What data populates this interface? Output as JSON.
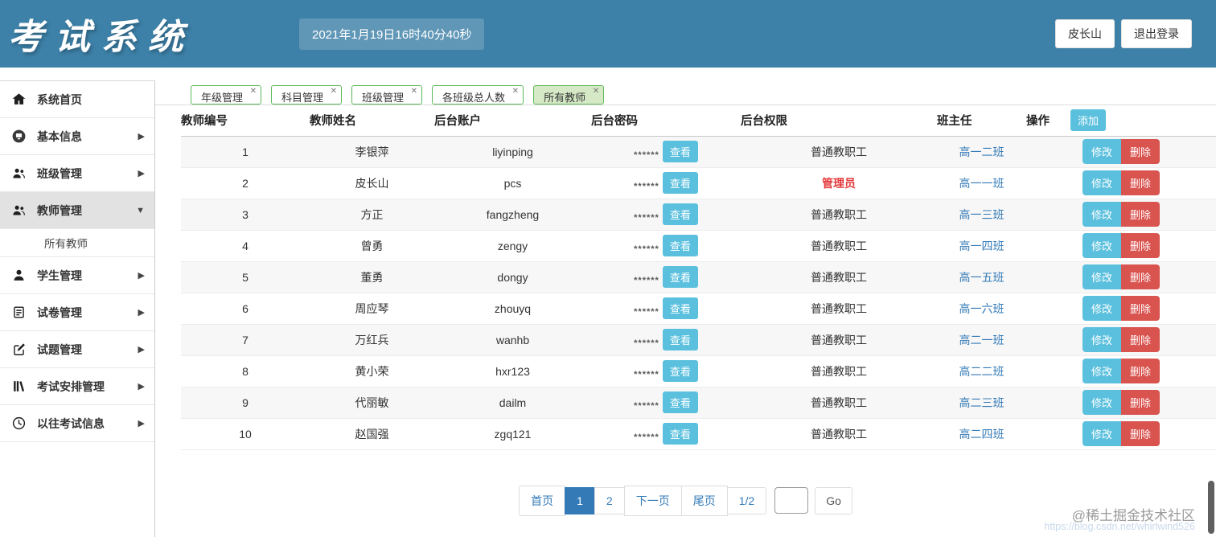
{
  "header": {
    "logo": "考试系统",
    "clock": "2021年1月19日16时40分40秒",
    "user_button": "皮长山",
    "logout_button": "退出登录"
  },
  "sidebar": {
    "items": [
      {
        "label": "系统首页",
        "icon": "home-icon"
      },
      {
        "label": "基本信息",
        "icon": "monitor-circle-icon"
      },
      {
        "label": "班级管理",
        "icon": "people-group-icon"
      },
      {
        "label": "教师管理",
        "icon": "people-group-icon"
      },
      {
        "label": "学生管理",
        "icon": "person-icon"
      },
      {
        "label": "试卷管理",
        "icon": "document-icon"
      },
      {
        "label": "试题管理",
        "icon": "compose-icon"
      },
      {
        "label": "考试安排管理",
        "icon": "books-icon"
      },
      {
        "label": "以往考试信息",
        "icon": "clock-icon"
      }
    ],
    "submenu_item": "所有教师"
  },
  "tabs": [
    {
      "label": "年级管理"
    },
    {
      "label": "科目管理"
    },
    {
      "label": "班级管理"
    },
    {
      "label": "各班级总人数"
    },
    {
      "label": "所有教师"
    }
  ],
  "table": {
    "headers": {
      "id": "教师编号",
      "name": "教师姓名",
      "account": "后台账户",
      "password": "后台密码",
      "permission": "后台权限",
      "head_teacher": "班主任",
      "actions": "操作"
    },
    "add_button": "添加",
    "view_button": "查看",
    "edit_button": "修改",
    "delete_button": "删除",
    "rows": [
      {
        "id": "1",
        "name": "李银萍",
        "account": "liyinping",
        "password_mask": "******",
        "permission": "普通教职工",
        "head_teacher": "高一二班"
      },
      {
        "id": "2",
        "name": "皮长山",
        "account": "pcs",
        "password_mask": "******",
        "permission": "管理员",
        "head_teacher": "高一一班"
      },
      {
        "id": "3",
        "name": "方正",
        "account": "fangzheng",
        "password_mask": "******",
        "permission": "普通教职工",
        "head_teacher": "高一三班"
      },
      {
        "id": "4",
        "name": "曾勇",
        "account": "zengy",
        "password_mask": "******",
        "permission": "普通教职工",
        "head_teacher": "高一四班"
      },
      {
        "id": "5",
        "name": "董勇",
        "account": "dongy",
        "password_mask": "******",
        "permission": "普通教职工",
        "head_teacher": "高一五班"
      },
      {
        "id": "6",
        "name": "周应琴",
        "account": "zhouyq",
        "password_mask": "******",
        "permission": "普通教职工",
        "head_teacher": "高一六班"
      },
      {
        "id": "7",
        "name": "万红兵",
        "account": "wanhb",
        "password_mask": "******",
        "permission": "普通教职工",
        "head_teacher": "高二一班"
      },
      {
        "id": "8",
        "name": "黄小荣",
        "account": "hxr123",
        "password_mask": "******",
        "permission": "普通教职工",
        "head_teacher": "高二二班"
      },
      {
        "id": "9",
        "name": "代丽敏",
        "account": "dailm",
        "password_mask": "******",
        "permission": "普通教职工",
        "head_teacher": "高二三班"
      },
      {
        "id": "10",
        "name": "赵国强",
        "account": "zgq121",
        "password_mask": "******",
        "permission": "普通教职工",
        "head_teacher": "高二四班"
      }
    ]
  },
  "pagination": {
    "first": "首页",
    "page1": "1",
    "page2": "2",
    "next": "下一页",
    "last": "尾页",
    "indicator": "1/2",
    "input_value": "",
    "go": "Go"
  },
  "watermark": {
    "line1": "@稀土掘金技术社区",
    "line2": "https://blog.csdn.net/whirlwind526"
  },
  "colors": {
    "header_bg": "#3d81a8",
    "tab_green": "#5cb85c",
    "tab_active_bg": "#d6e9c6",
    "link_blue": "#337ab7",
    "info_blue": "#5bc0de",
    "danger_red": "#d9534f",
    "admin_red": "#e4393c"
  }
}
